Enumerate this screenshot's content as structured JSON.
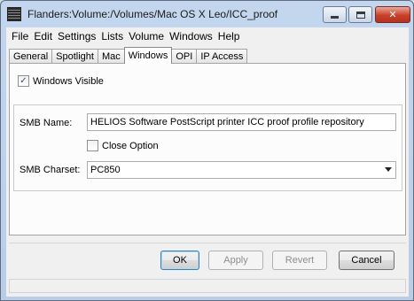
{
  "window": {
    "title": "Flanders:Volume:/Volumes/Mac OS X Leo/ICC_proof",
    "controls": {
      "minimize": "minimize-icon",
      "maximize": "maximize-icon",
      "close": "close-icon"
    }
  },
  "menubar": [
    "File",
    "Edit",
    "Settings",
    "Lists",
    "Volume",
    "Windows",
    "Help"
  ],
  "tabs": [
    "General",
    "Spotlight",
    "Mac",
    "Windows",
    "OPI",
    "IP Access"
  ],
  "active_tab": "Windows",
  "form": {
    "windows_visible_label": "Windows Visible",
    "windows_visible_checked": true,
    "smb_name_label": "SMB Name:",
    "smb_name_value": "HELIOS Software PostScript printer ICC proof profile repository",
    "close_option_label": "Close Option",
    "close_option_checked": false,
    "smb_charset_label": "SMB Charset:",
    "smb_charset_value": "PC850"
  },
  "buttons": {
    "ok": "OK",
    "apply": "Apply",
    "revert": "Revert",
    "cancel": "Cancel"
  },
  "colors": {
    "titlebar": "#c3d6ee",
    "close_button": "#c8402a",
    "checkmark": "#2b4a87",
    "default_button_border": "#3c7fb1"
  }
}
